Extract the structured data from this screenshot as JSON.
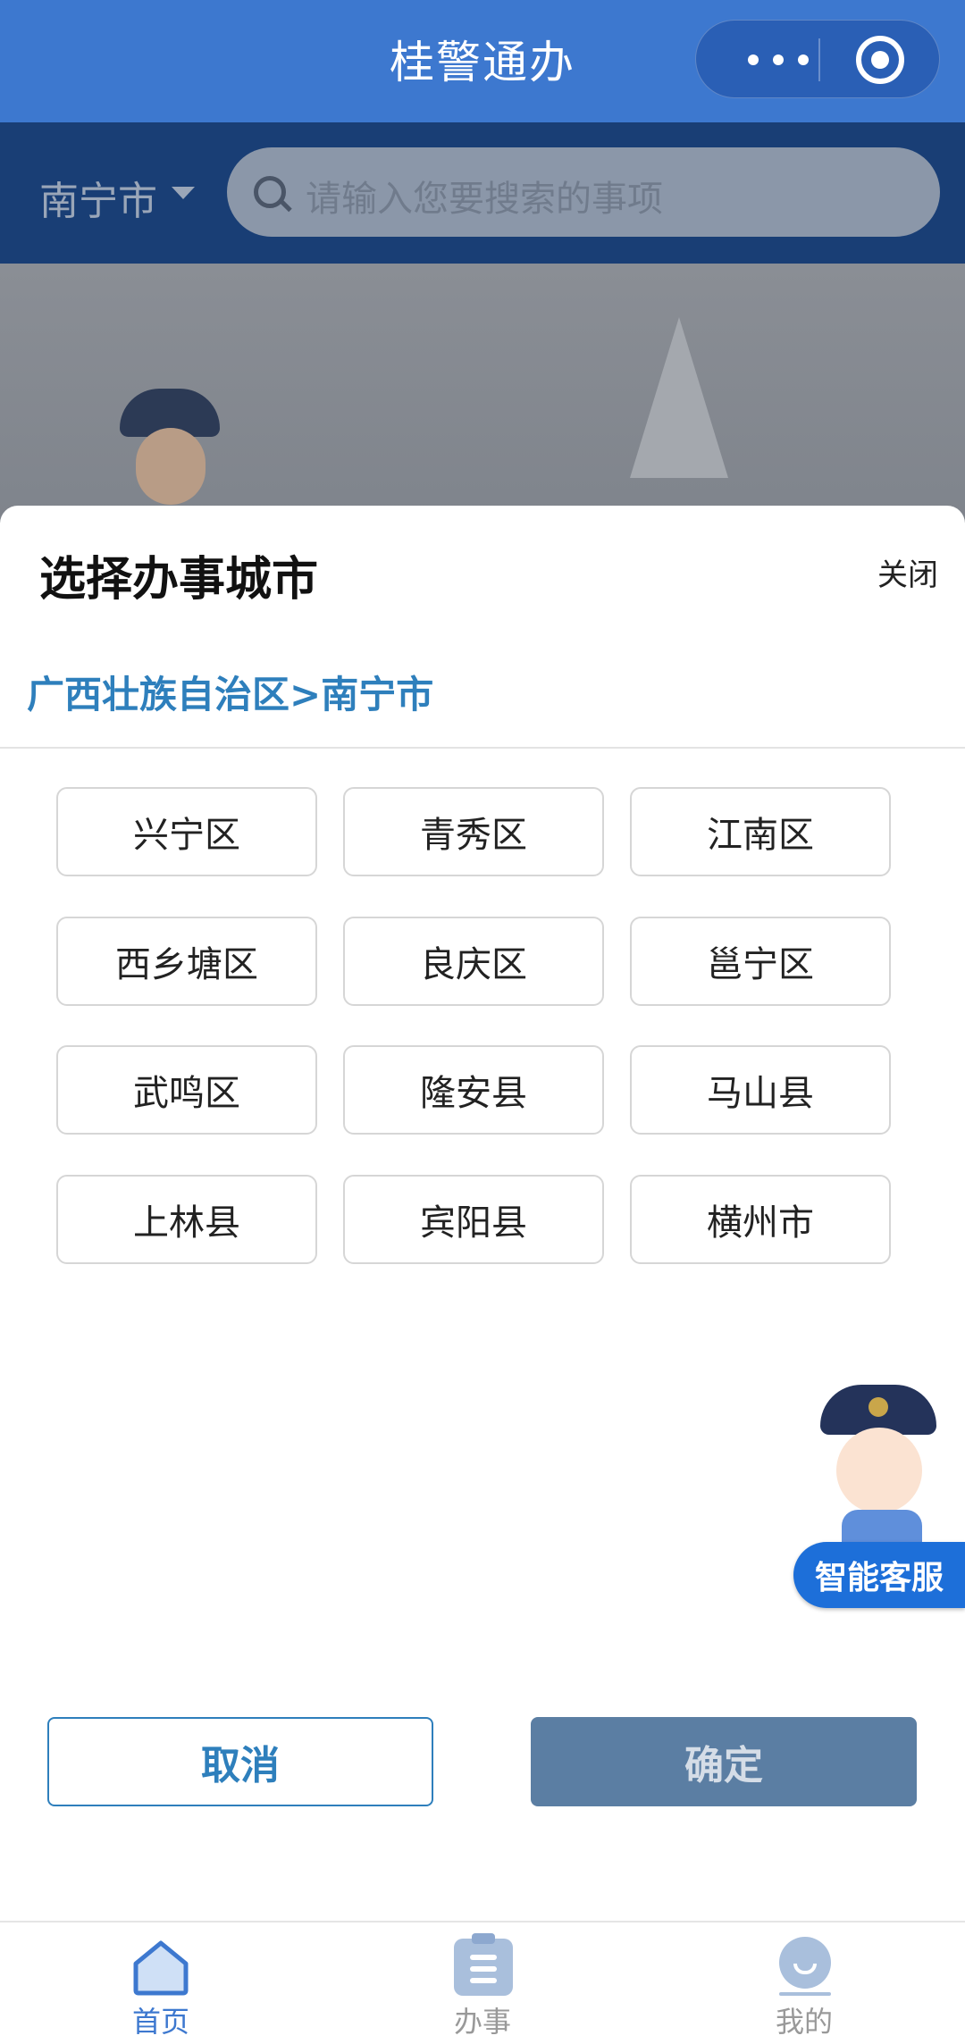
{
  "app": {
    "title": "桂警通办",
    "capsule_icons": [
      "more-icon",
      "target-icon"
    ]
  },
  "background_page": {
    "city": "南宁市",
    "search_placeholder": "请输入您要搜索的事项"
  },
  "city_picker": {
    "title": "选择办事城市",
    "close_label": "关闭",
    "breadcrumb": "广西壮族自治区>南宁市",
    "districts": [
      "兴宁区",
      "青秀区",
      "江南区",
      "西乡塘区",
      "良庆区",
      "邕宁区",
      "武鸣区",
      "隆安县",
      "马山县",
      "上林县",
      "宾阳县",
      "横州市"
    ],
    "cancel_label": "取消",
    "confirm_label": "确定"
  },
  "customer_service": {
    "label": "智能客服"
  },
  "tabbar": {
    "items": [
      {
        "label": "首页",
        "icon": "home-icon",
        "active": true
      },
      {
        "label": "办事",
        "icon": "clipboard-icon",
        "active": false
      },
      {
        "label": "我的",
        "icon": "user-icon",
        "active": false
      }
    ]
  },
  "colors": {
    "primary": "#3d78cf",
    "link": "#2e7fbc",
    "confirm_disabled": "#5b7ea3"
  }
}
